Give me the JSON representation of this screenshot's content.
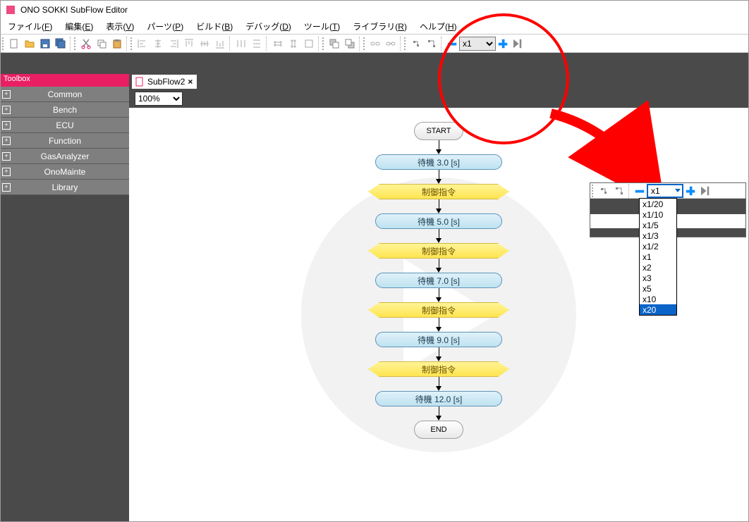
{
  "app": {
    "title": "ONO SOKKI SubFlow Editor",
    "menus": [
      {
        "label": "ファイル",
        "accel": "F"
      },
      {
        "label": "編集",
        "accel": "E"
      },
      {
        "label": "表示",
        "accel": "V"
      },
      {
        "label": "パーツ",
        "accel": "P"
      },
      {
        "label": "ビルド",
        "accel": "B"
      },
      {
        "label": "デバッグ",
        "accel": "D"
      },
      {
        "label": "ツール",
        "accel": "T"
      },
      {
        "label": "ライブラリ",
        "accel": "R"
      },
      {
        "label": "ヘルプ",
        "accel": "H"
      }
    ]
  },
  "speed": {
    "current": "x1",
    "options": [
      "x1/20",
      "x1/10",
      "x1/5",
      "x1/3",
      "x1/2",
      "x1",
      "x2",
      "x3",
      "x5",
      "x10",
      "x20"
    ],
    "highlighted": "x20"
  },
  "toolbox": {
    "title": "Toolbox",
    "items": [
      "Common",
      "Bench",
      "ECU",
      "Function",
      "GasAnalyzer",
      "OnoMainte",
      "Library"
    ]
  },
  "tab": {
    "label": "SubFlow2"
  },
  "zoom": {
    "value": "100%"
  },
  "flow": {
    "start": "START",
    "end": "END",
    "nodes": [
      {
        "type": "process",
        "label": "待機 3.0 [s]"
      },
      {
        "type": "command",
        "label": "制御指令"
      },
      {
        "type": "process",
        "label": "待機 5.0 [s]"
      },
      {
        "type": "command",
        "label": "制御指令"
      },
      {
        "type": "process",
        "label": "待機 7.0 [s]"
      },
      {
        "type": "command",
        "label": "制御指令"
      },
      {
        "type": "process",
        "label": "待機 9.0 [s]"
      },
      {
        "type": "command",
        "label": "制御指令"
      },
      {
        "type": "process",
        "label": "待機 12.0 [s]"
      }
    ]
  }
}
